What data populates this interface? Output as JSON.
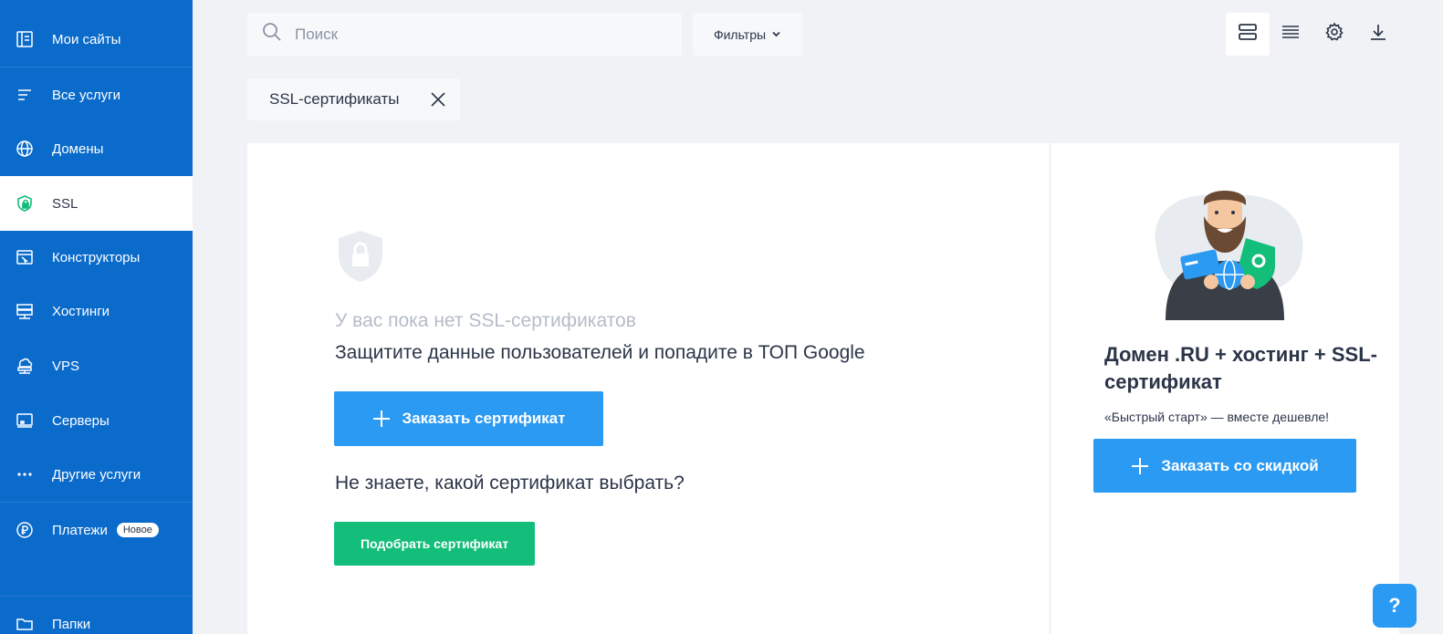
{
  "sidebar": {
    "items": [
      {
        "label": "Мои сайты",
        "icon": "sites-icon"
      },
      {
        "label": "Все услуги",
        "icon": "list-icon"
      },
      {
        "label": "Домены",
        "icon": "globe-icon"
      },
      {
        "label": "SSL",
        "icon": "shield-lock-icon"
      },
      {
        "label": "Конструкторы",
        "icon": "constructor-icon"
      },
      {
        "label": "Хостинги",
        "icon": "hosting-icon"
      },
      {
        "label": "VPS",
        "icon": "cloud-server-icon"
      },
      {
        "label": "Серверы",
        "icon": "server-icon"
      },
      {
        "label": "Другие услуги",
        "icon": "more-icon"
      },
      {
        "label": "Платежи",
        "icon": "ruble-icon",
        "badge": "Новое"
      },
      {
        "label": "Папки",
        "icon": "folder-icon"
      }
    ],
    "active": "SSL"
  },
  "search": {
    "placeholder": "Поиск"
  },
  "filters": {
    "label": "Фильтры"
  },
  "chip": {
    "label": "SSL-сертификаты"
  },
  "main": {
    "empty_title": "У вас пока нет SSL-сертификатов",
    "empty_subtitle": "Защитите данные пользователей и попадите в ТОП Google",
    "order_button": "Заказать сертификат",
    "question": "Не знаете, какой сертификат выбрать?",
    "pick_button": "Подобрать сертификат"
  },
  "promo": {
    "title": "Домен .RU + хостинг + SSL-сертификат",
    "subtitle": "«Быстрый старт» — вместе дешевле!",
    "button": "Заказать со скидкой"
  },
  "help": {
    "label": "?"
  },
  "colors": {
    "sidebar_bg": "#0b6bcb",
    "primary_blue": "#2b9af3",
    "green": "#13bd7a",
    "background": "#f0f2f6"
  }
}
